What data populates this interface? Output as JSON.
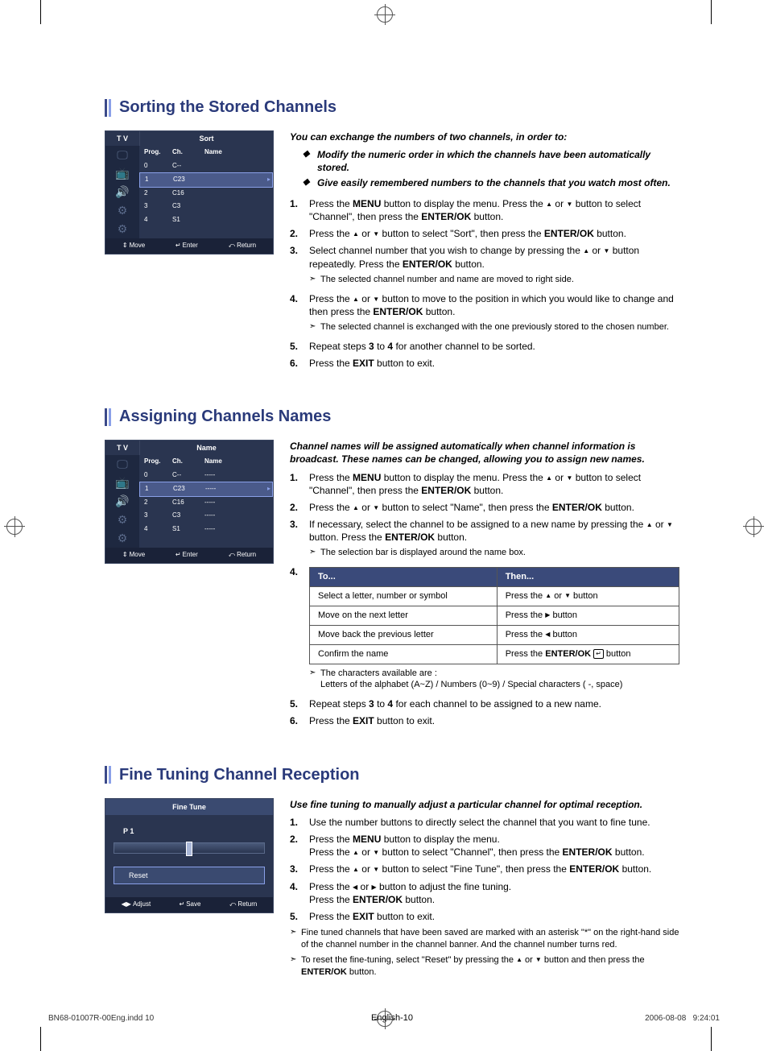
{
  "sections": [
    {
      "title": "Sorting the Stored Channels",
      "osd": {
        "type": "list",
        "corner": "T V",
        "title": "Sort",
        "headers": [
          "Prog.",
          "Ch.",
          "Name"
        ],
        "rows": [
          {
            "prog": "0",
            "ch": "C--",
            "name": ""
          },
          {
            "prog": "1",
            "ch": "C23",
            "name": "",
            "selected": true
          },
          {
            "prog": "2",
            "ch": "C16",
            "name": ""
          },
          {
            "prog": "3",
            "ch": "C3",
            "name": ""
          },
          {
            "prog": "4",
            "ch": "S1",
            "name": ""
          }
        ],
        "footer": [
          "Move",
          "Enter",
          "Return"
        ],
        "footer_icons": [
          "⇕",
          "↵",
          "⤺"
        ]
      },
      "intro": "You can exchange the numbers of two channels, in order to:",
      "bullets": [
        "Modify the numeric order in which the channels have been automatically stored.",
        "Give easily remembered numbers to the channels that you watch most often."
      ],
      "steps": [
        {
          "n": "1.",
          "html": "Press the <b>MENU</b> button to display the menu.  Press the <span class='tri'>▲</span> or <span class='tri'>▼</span> button to select \"Channel\", then press the <b>ENTER/OK</b> button."
        },
        {
          "n": "2.",
          "html": "Press the <span class='tri'>▲</span> or <span class='tri'>▼</span> button to select \"Sort\", then press the <b>ENTER/OK</b> button."
        },
        {
          "n": "3.",
          "html": "Select channel number that you wish to change by pressing the <span class='tri'>▲</span> or <span class='tri'>▼</span> button repeatedly. Press the <b>ENTER/OK</b> button.",
          "notes": [
            "The selected channel number and name are moved to right side."
          ]
        },
        {
          "n": "4.",
          "html": "Press the <span class='tri'>▲</span> or <span class='tri'>▼</span> button to move to the position in which you would like to change and then press the  <b>ENTER/OK</b> button.",
          "notes": [
            "The selected channel is exchanged with the one previously stored to the chosen number."
          ]
        },
        {
          "n": "5.",
          "html": "Repeat steps <b>3</b> to <b>4</b> for another channel to be sorted."
        },
        {
          "n": "6.",
          "html": "Press the <b>EXIT</b> button to exit."
        }
      ]
    },
    {
      "title": "Assigning Channels Names",
      "osd": {
        "type": "list",
        "corner": "T V",
        "title": "Name",
        "headers": [
          "Prog.",
          "Ch.",
          "Name"
        ],
        "rows": [
          {
            "prog": "0",
            "ch": "C--",
            "name": "-----"
          },
          {
            "prog": "1",
            "ch": "C23",
            "name": "-----",
            "selected": true
          },
          {
            "prog": "2",
            "ch": "C16",
            "name": "-----"
          },
          {
            "prog": "3",
            "ch": "C3",
            "name": "-----"
          },
          {
            "prog": "4",
            "ch": "S1",
            "name": "-----"
          }
        ],
        "footer": [
          "Move",
          "Enter",
          "Return"
        ],
        "footer_icons": [
          "⇕",
          "↵",
          "⤺"
        ]
      },
      "intro": "Channel names will be assigned automatically when channel information is broadcast. These names can be changed, allowing you to assign new names.",
      "steps": [
        {
          "n": "1.",
          "html": "Press the <b>MENU</b> button to display the menu.  Press the <span class='tri'>▲</span> or <span class='tri'>▼</span> button to select \"Channel\", then press the <b>ENTER/OK</b> button."
        },
        {
          "n": "2.",
          "html": "Press the <span class='tri'>▲</span> or <span class='tri'>▼</span> button to select \"Name\", then press the <b>ENTER/OK</b> button."
        },
        {
          "n": "3.",
          "html": "If necessary, select the channel to be assigned to a new name by pressing the <span class='tri'>▲</span> or <span class='tri'>▼</span> button. Press the <b>ENTER/OK</b> button.",
          "notes": [
            "The selection bar is displayed around the name box."
          ]
        },
        {
          "n": "4.",
          "table": {
            "header": [
              "To...",
              "Then..."
            ],
            "rows": [
              [
                "Select a letter, number or symbol",
                "Press the <span class='tri'>▲</span> or <span class='tri'>▼</span> button"
              ],
              [
                "Move on the next letter",
                "Press the <span class='tri'>▶</span> button"
              ],
              [
                "Move back the previous letter",
                "Press the <span class='tri'>◀</span> button"
              ],
              [
                "Confirm the name",
                "Press the <b>ENTER/OK</b> <span class='enter-icon'>↵</span> button"
              ]
            ]
          },
          "notes": [
            "The characters available are :<br>Letters of the alphabet (A~Z) / Numbers (0~9) / Special characters ( -, space)"
          ]
        },
        {
          "n": "5.",
          "html": "Repeat steps <b>3</b> to <b>4</b> for each channel to be assigned to a new name."
        },
        {
          "n": "6.",
          "html": "Press the <b>EXIT</b> button to exit."
        }
      ]
    },
    {
      "title": "Fine Tuning Channel Reception",
      "osd": {
        "type": "finetune",
        "title": "Fine Tune",
        "channel": "P  1",
        "value": "0",
        "reset": "Reset",
        "footer": [
          "Adjust",
          "Save",
          "Return"
        ],
        "footer_icons": [
          "◀▶",
          "↵",
          "⤺"
        ]
      },
      "intro": "Use fine tuning to manually adjust a particular channel for optimal reception.",
      "steps": [
        {
          "n": "1.",
          "html": "Use the number buttons to directly select the channel that you want to fine tune."
        },
        {
          "n": "2.",
          "html": "Press the <b>MENU</b> button to display the menu.<br>Press the <span class='tri'>▲</span> or <span class='tri'>▼</span> button to select \"Channel\", then press the <b>ENTER/OK</b> button."
        },
        {
          "n": "3.",
          "html": "Press the <span class='tri'>▲</span> or <span class='tri'>▼</span> button to select \"Fine Tune\", then press the <b>ENTER/OK</b> button."
        },
        {
          "n": "4.",
          "html": "Press the <span class='tri'>◀</span> or <span class='tri'>▶</span> button to adjust the fine tuning.<br>Press the <b>ENTER/OK</b> button."
        },
        {
          "n": "5.",
          "html": "Press the <b>EXIT</b> button to exit."
        }
      ],
      "trailing_notes": [
        "Fine tuned channels that have been saved are marked with an asterisk \"*\" on the right-hand side of the channel number in the channel banner.  And the channel number turns red.",
        "To reset the fine-tuning, select \"Reset\" by pressing the <span class='tri'>▲</span> or <span class='tri'>▼</span> button and then press the <b>ENTER/OK</b> button."
      ]
    }
  ],
  "page_label": "English-10",
  "footer": {
    "file": "BN68-01007R-00Eng.indd   10",
    "date": "2006-08-08",
    "time": "9:24:01"
  }
}
